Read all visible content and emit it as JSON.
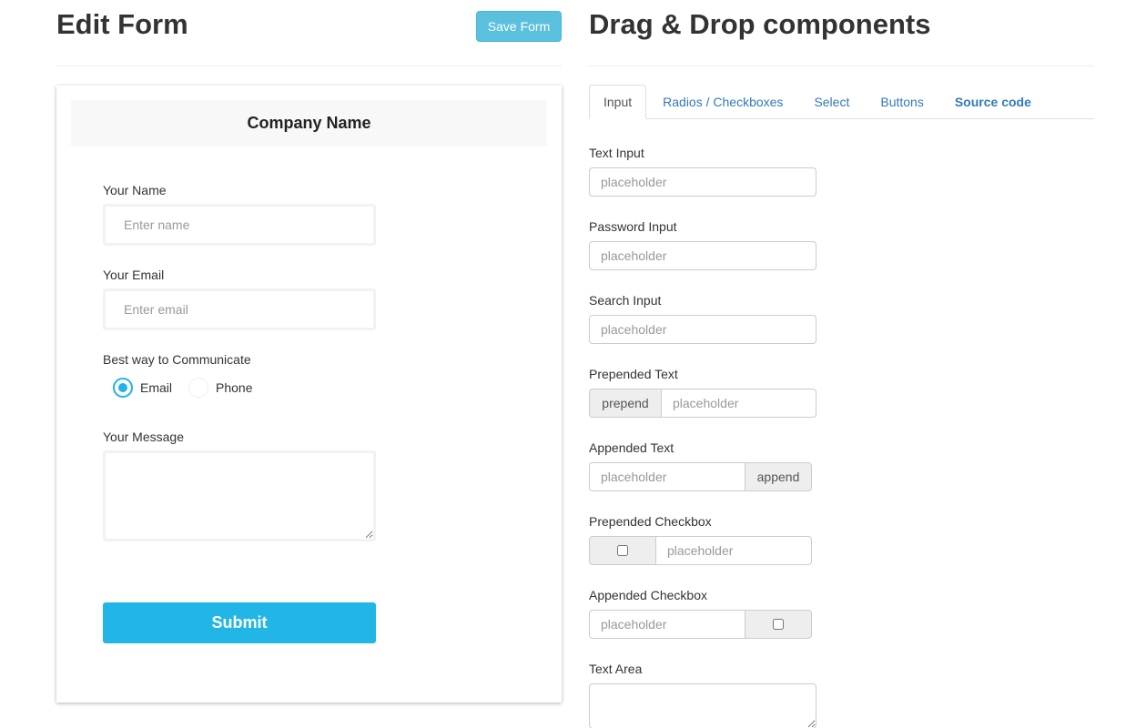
{
  "edit_form": {
    "title": "Edit Form",
    "save_label": "Save Form",
    "company_name": "Company Name",
    "name_label": "Your Name",
    "name_placeholder": "Enter name",
    "email_label": "Your Email",
    "email_placeholder": "Enter email",
    "communicate_label": "Best way to Communicate",
    "radio_options": [
      {
        "label": "Email",
        "checked": true
      },
      {
        "label": "Phone",
        "checked": false
      }
    ],
    "message_label": "Your Message",
    "submit_label": "Submit"
  },
  "components": {
    "title": "Drag & Drop components",
    "tabs": [
      {
        "label": "Input",
        "active": true
      },
      {
        "label": "Radios / Checkboxes",
        "active": false
      },
      {
        "label": "Select",
        "active": false
      },
      {
        "label": "Buttons",
        "active": false
      },
      {
        "label": "Source code",
        "active": false
      }
    ],
    "text_input_label": "Text Input",
    "password_input_label": "Password Input",
    "search_input_label": "Search Input",
    "prepended_text_label": "Prepended Text",
    "appended_text_label": "Appended Text",
    "prepended_checkbox_label": "Prepended Checkbox",
    "appended_checkbox_label": "Appended Checkbox",
    "text_area_label": "Text Area",
    "placeholder": "placeholder",
    "prepend_addon": "prepend",
    "append_addon": "append"
  },
  "colors": {
    "accent": "#21b6e6",
    "save_button": "#5bc0de",
    "link": "#337ab7"
  }
}
